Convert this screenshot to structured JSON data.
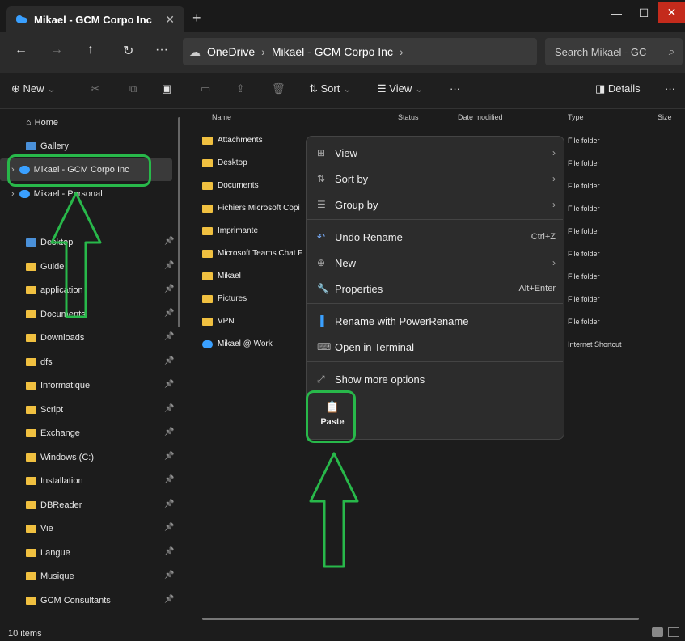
{
  "tab": {
    "title": "Mikael - GCM Corpo Inc",
    "close": "✕",
    "new": "+"
  },
  "window": {
    "minimize": "—",
    "maximize": "☐",
    "close": "✕"
  },
  "nav": {
    "back": "←",
    "forward": "→",
    "up": "↑",
    "refresh": "↻",
    "more": "···"
  },
  "breadcrumb": [
    "OneDrive",
    "Mikael - GCM Corpo Inc"
  ],
  "search": {
    "placeholder": "Search Mikael - GC"
  },
  "toolbar": {
    "new": "New",
    "sort": "Sort",
    "view": "View",
    "more": "···",
    "details": "Details"
  },
  "sidebar": {
    "top": [
      {
        "label": "Home"
      },
      {
        "label": "Gallery"
      },
      {
        "label": "Mikael - GCM Corpo Inc"
      },
      {
        "label": "Mikael - Personal"
      }
    ],
    "pinned": [
      "Desktop",
      "Guide",
      "application",
      "Documents",
      "Downloads",
      "dfs",
      "Informatique",
      "Script",
      "Exchange",
      "Windows (C:)",
      "Installation",
      "DBReader",
      "Vie",
      "Langue",
      "Musique",
      "GCM Consultants"
    ]
  },
  "columns": {
    "name": "Name",
    "status": "Status",
    "date": "Date modified",
    "type": "Type",
    "size": "Size"
  },
  "files": [
    {
      "name": "Attachments",
      "type": "File folder"
    },
    {
      "name": "Desktop",
      "type": "File folder"
    },
    {
      "name": "Documents",
      "type": "File folder"
    },
    {
      "name": "Fichiers Microsoft Copi",
      "type": "File folder"
    },
    {
      "name": "Imprimante",
      "type": "File folder"
    },
    {
      "name": "Microsoft Teams Chat F",
      "type": "File folder"
    },
    {
      "name": "Mikael",
      "type": "File folder"
    },
    {
      "name": "Pictures",
      "type": "File folder"
    },
    {
      "name": "VPN",
      "type": "File folder"
    },
    {
      "name": "Mikael @ Work",
      "type": "Internet Shortcut"
    }
  ],
  "context_menu": {
    "view": "View",
    "sort_by": "Sort by",
    "group_by": "Group by",
    "undo_rename": "Undo Rename",
    "undo_shortcut": "Ctrl+Z",
    "new": "New",
    "properties": "Properties",
    "properties_shortcut": "Alt+Enter",
    "rename_power": "Rename with PowerRename",
    "open_terminal": "Open in Terminal",
    "more_options": "Show more options",
    "paste": "Paste"
  },
  "status": {
    "items": "10 items"
  },
  "colors": {
    "highlight": "#28b84a",
    "folder": "#f0c040",
    "close": "#c42b1c"
  }
}
